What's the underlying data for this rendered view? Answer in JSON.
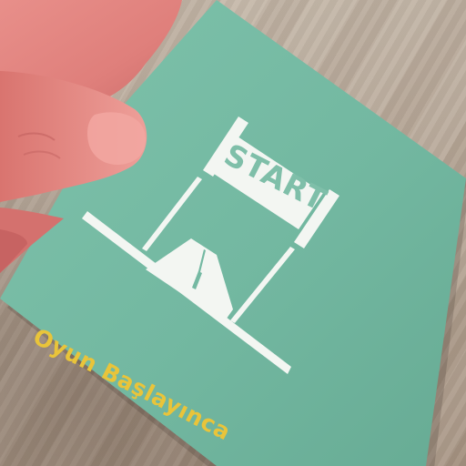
{
  "card": {
    "banner_text": "START",
    "caption": "Oyun Başlayınca"
  },
  "colors": {
    "card_green": "#74b9a2",
    "banner_white": "#f3f6f2",
    "caption_yellow": "#e9c43a",
    "skin": "#e07f7c"
  },
  "icons": {
    "finish_arch": "start-arch-icon",
    "road": "road-icon"
  }
}
